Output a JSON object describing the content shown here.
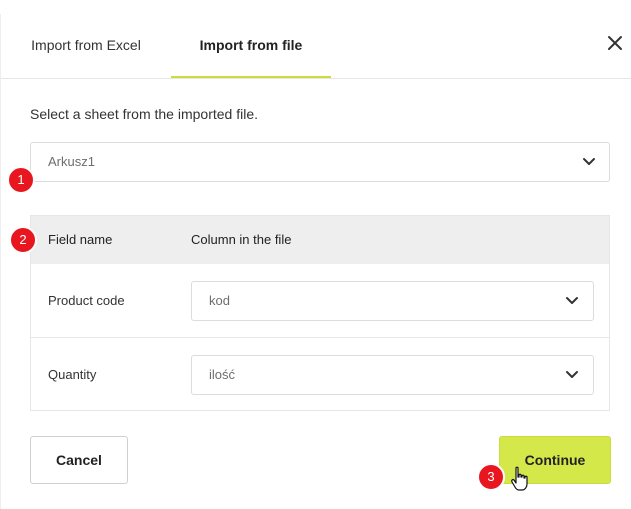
{
  "tabs": [
    {
      "label": "Import from Excel",
      "active": false
    },
    {
      "label": "Import from file",
      "active": true
    }
  ],
  "close_icon": "close-icon",
  "instruction": "Select a sheet from the imported file.",
  "sheet_select": {
    "value": "Arkusz1"
  },
  "mapping": {
    "headers": {
      "field": "Field name",
      "column": "Column in the file"
    },
    "rows": [
      {
        "field": "Product code",
        "column": "kod"
      },
      {
        "field": "Quantity",
        "column": "ilość"
      }
    ]
  },
  "buttons": {
    "cancel": "Cancel",
    "continue": "Continue"
  },
  "markers": [
    "1",
    "2",
    "3"
  ],
  "colors": {
    "accent": "#d4e84a",
    "marker": "#e8171f",
    "header_bg": "#eeeeee"
  }
}
